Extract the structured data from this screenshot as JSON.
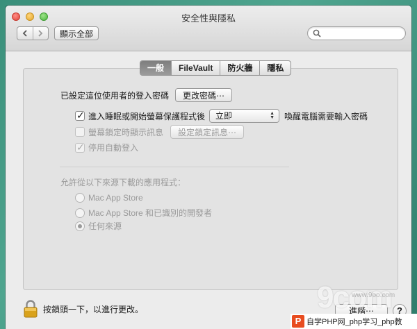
{
  "window": {
    "title": "安全性與隱私"
  },
  "toolbar": {
    "show_all_label": "顯示全部",
    "search_placeholder": "",
    "back_icon": "chevron-left-icon",
    "forward_icon": "chevron-right-icon"
  },
  "tabs": [
    {
      "label": "一般",
      "active": true
    },
    {
      "label": "FileVault",
      "active": false
    },
    {
      "label": "防火牆",
      "active": false
    },
    {
      "label": "隱私",
      "active": false
    }
  ],
  "general": {
    "password_set_label": "已設定這位使用者的登入密碼",
    "change_password_button": "更改密碼⋯",
    "require_password": {
      "checked": true,
      "label_before": "進入睡眠或開始螢幕保護程式後",
      "select_value": "立即",
      "label_after": "喚醒電腦需要輸入密碼"
    },
    "show_message": {
      "checked": false,
      "disabled": true,
      "label": "螢幕鎖定時顯示訊息",
      "button": "設定鎖定訊息⋯"
    },
    "disable_auto_login": {
      "checked": true,
      "disabled": true,
      "label": "停用自動登入"
    }
  },
  "downloads": {
    "heading": "允許從以下來源下載的應用程式：",
    "options": [
      {
        "label": "Mac App Store",
        "selected": false
      },
      {
        "label": "Mac App Store 和已識別的開發者",
        "selected": false
      },
      {
        "label": "任何來源",
        "selected": true
      }
    ]
  },
  "footer": {
    "lock_label": "按鎖頭一下，以進行更改。",
    "advanced_button": "進階⋯",
    "help_label": "?"
  },
  "watermark": {
    "logo_text": "9com",
    "site_text": "www.9oo.com",
    "banner_text": "自学PHP网_php学习_php教"
  },
  "colors": {
    "active_tab": "#8a8a8a",
    "window_bg": "#ececec",
    "desktop": "#3a8f7a"
  }
}
